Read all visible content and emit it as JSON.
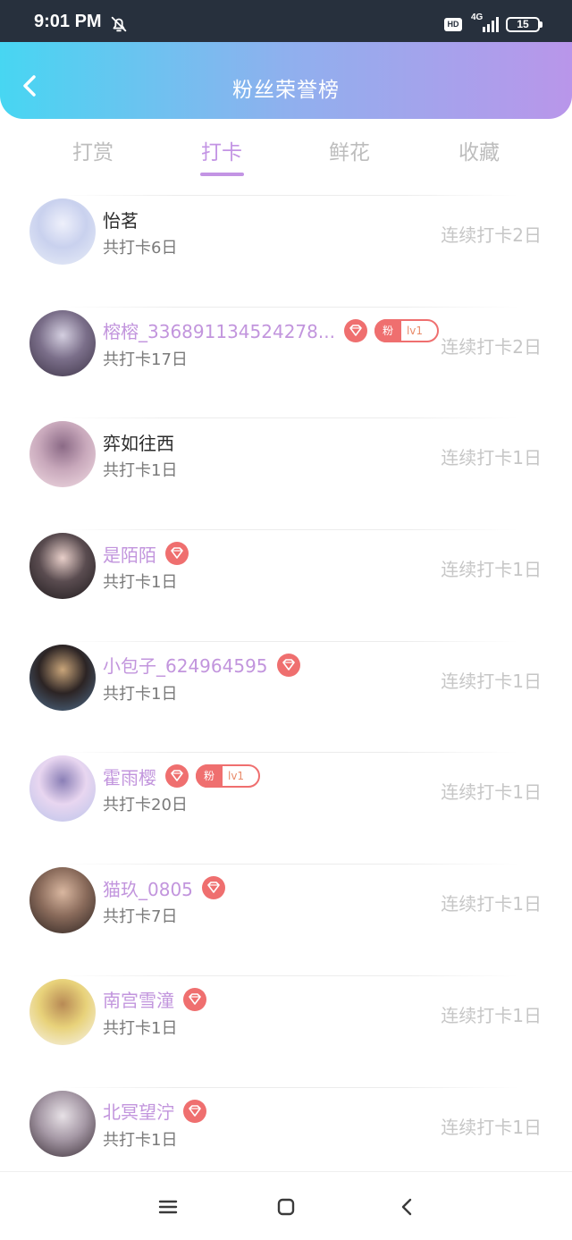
{
  "status_bar": {
    "time": "9:01 PM",
    "network": "4G",
    "hd": "HD",
    "battery": "15"
  },
  "header": {
    "title": "粉丝荣誉榜"
  },
  "tabs": [
    {
      "label": "打赏",
      "active": false
    },
    {
      "label": "打卡",
      "active": true
    },
    {
      "label": "鲜花",
      "active": false
    },
    {
      "label": "收藏",
      "active": false
    }
  ],
  "fans": [
    {
      "name": "怡茗",
      "total": "共打卡6日",
      "streak": "连续打卡2日",
      "highlight": false,
      "gem": false,
      "fan_badge": null,
      "avatar_colors": [
        "#e9eef8",
        "#c9d1ee",
        "#eef0fb"
      ]
    },
    {
      "name": "榕榕_336891134524278...",
      "total": "共打卡17日",
      "streak": "连续打卡2日",
      "highlight": true,
      "gem": true,
      "fan_badge": {
        "label": "粉",
        "level": "lv1"
      },
      "avatar_colors": [
        "#3c3346",
        "#7b6f8a",
        "#d4cfe0"
      ]
    },
    {
      "name": "弈如往西",
      "total": "共打卡1日",
      "streak": "连续打卡1日",
      "highlight": false,
      "gem": false,
      "fan_badge": null,
      "avatar_colors": [
        "#f2dde4",
        "#c8a8bb",
        "#8b6a86"
      ]
    },
    {
      "name": "是陌陌",
      "total": "共打卡1日",
      "streak": "连续打卡1日",
      "highlight": true,
      "gem": true,
      "fan_badge": null,
      "avatar_colors": [
        "#1e1a1c",
        "#5a4c50",
        "#e8cfc9"
      ]
    },
    {
      "name": "小包子_624964595",
      "total": "共打卡1日",
      "streak": "连续打卡1日",
      "highlight": true,
      "gem": true,
      "fan_badge": null,
      "avatar_colors": [
        "#4f6f8f",
        "#2c2424",
        "#c9a57a"
      ]
    },
    {
      "name": "霍雨樱",
      "total": "共打卡20日",
      "streak": "连续打卡1日",
      "highlight": true,
      "gem": true,
      "fan_badge": {
        "label": "粉",
        "level": "lv1"
      },
      "avatar_colors": [
        "#b9c3ea",
        "#e8d6f0",
        "#8a7fb6"
      ]
    },
    {
      "name": "猫玖_0805",
      "total": "共打卡7日",
      "streak": "连续打卡1日",
      "highlight": true,
      "gem": true,
      "fan_badge": null,
      "avatar_colors": [
        "#2b2220",
        "#8a6b5b",
        "#d9b7a0"
      ]
    },
    {
      "name": "南宫雪潼",
      "total": "共打卡1日",
      "streak": "连续打卡1日",
      "highlight": true,
      "gem": true,
      "fan_badge": null,
      "avatar_colors": [
        "#f7f4ee",
        "#e8d27a",
        "#b88a55"
      ]
    },
    {
      "name": "北冥望泞",
      "total": "共打卡1日",
      "streak": "连续打卡1日",
      "highlight": true,
      "gem": true,
      "fan_badge": null,
      "avatar_colors": [
        "#3a2e36",
        "#a598a5",
        "#e7e1e6"
      ]
    }
  ]
}
